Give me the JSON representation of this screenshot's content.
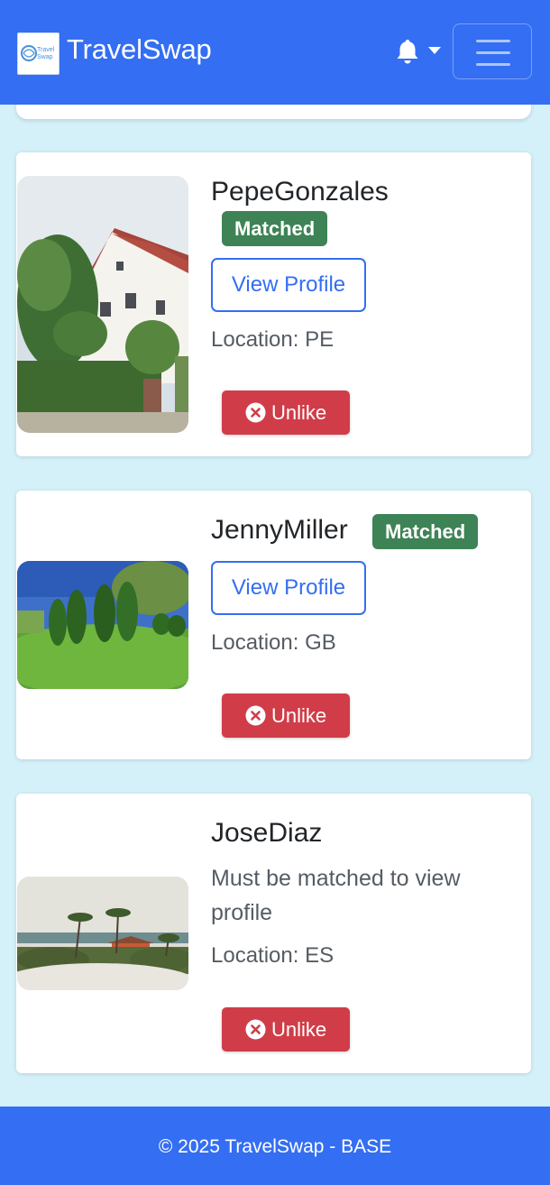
{
  "navbar": {
    "brand_name": "TravelSwap",
    "logo_text_1": "Travel",
    "logo_text_2": "Swap",
    "notifications_icon": "bell-icon",
    "dropdown_icon": "caret-down-icon",
    "menu_icon": "hamburger-icon",
    "brand_color": "#346ef2"
  },
  "matches": [
    {
      "username": "PepeGonzales",
      "status": "Matched",
      "view_label": "View Profile",
      "location": "Location: PE",
      "unlike_label": "Unlike",
      "image": "white house with red roof"
    },
    {
      "username": "JennyMiller",
      "status": "Matched",
      "view_label": "View Profile",
      "location": "Location: GB",
      "unlike_label": "Unlike",
      "image": "green garden with cypress trees"
    },
    {
      "username": "JoseDiaz",
      "note": "Must be matched to view profile",
      "location": "Location: ES",
      "unlike_label": "Unlike",
      "image": "beach house with palm trees"
    }
  ],
  "footer": {
    "text": "© 2025 TravelSwap - BASE"
  },
  "colors": {
    "background": "#d4f0f8",
    "matched_badge": "#3e8356",
    "unlike_button": "#d03d48"
  }
}
